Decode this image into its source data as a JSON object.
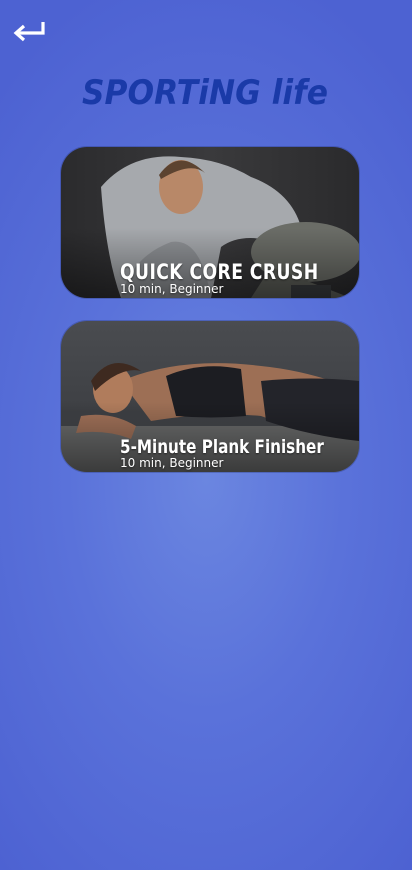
{
  "header": {
    "back_icon": "return-arrow-icon",
    "logo_text": "SPORTiNG life"
  },
  "workouts": [
    {
      "title": "QUICK CORE CRUSH",
      "subtitle": "10 min, Beginner"
    },
    {
      "title": "5-Minute Plank Finisher",
      "subtitle": "10 min, Beginner"
    }
  ],
  "colors": {
    "background": "#5a72da",
    "logo": "#1a3aa8",
    "card_text": "#ffffff"
  }
}
